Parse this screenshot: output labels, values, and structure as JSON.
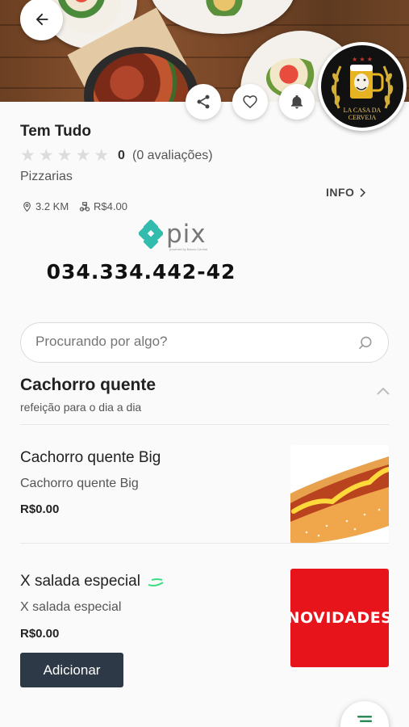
{
  "store": {
    "name": "Tem Tudo",
    "rating_value": "0",
    "rating_count": "(0 avaliações)",
    "category": "Pizzarias",
    "distance": "3.2 KM",
    "delivery_fee": "R$4.00",
    "info_label": "INFO",
    "logo_text_line1": "LA CASA DA",
    "logo_text_line2": "CERVEJA"
  },
  "pix": {
    "brand": "pix",
    "brand_sub": "powered by Banco Central",
    "key": "034.334.442-42"
  },
  "search": {
    "placeholder": "Procurando por algo?"
  },
  "section": {
    "title": "Cachorro quente",
    "subtitle": "refeição para o dia a dia"
  },
  "items": [
    {
      "name": "Cachorro quente Big",
      "description": "Cachorro quente Big",
      "price": "R$0.00"
    },
    {
      "name": "X salada especial",
      "description": "X salada especial",
      "price": "R$0.00",
      "image_text": "NOVIDADES",
      "button_label": "Adicionar"
    }
  ],
  "colors": {
    "button": "#2e3947",
    "pix_teal": "#32bcad",
    "novidades_red": "#e8141c"
  },
  "icons": [
    "back-arrow-icon",
    "share-icon",
    "heart-icon",
    "bell-icon",
    "location-pin-icon",
    "delivery-bike-icon",
    "chevron-right-icon",
    "search-icon",
    "chevron-up-icon",
    "leaf-icon"
  ]
}
